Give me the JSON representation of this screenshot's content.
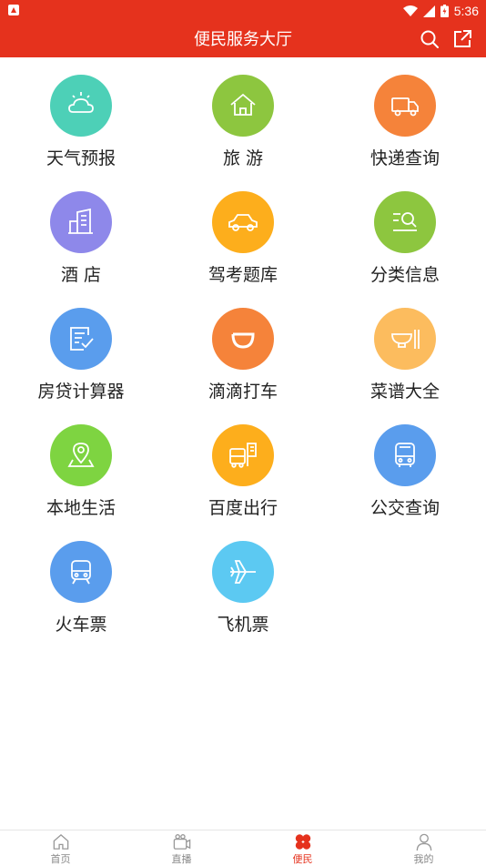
{
  "status_bar": {
    "time": "5:36"
  },
  "header": {
    "title": "便民服务大厅",
    "search_icon": "search-icon",
    "share_icon": "share-icon",
    "color": "#e5321d"
  },
  "services": [
    {
      "label": "天气预报",
      "icon": "weather-icon",
      "color": "#4dd0b7"
    },
    {
      "label": "旅 游",
      "icon": "travel-icon",
      "color": "#8dc63f"
    },
    {
      "label": "快递查询",
      "icon": "express-truck-icon",
      "color": "#f5833a"
    },
    {
      "label": "酒 店",
      "icon": "hotel-icon",
      "color": "#8e88ea"
    },
    {
      "label": "驾考题库",
      "icon": "car-icon",
      "color": "#fdae1c"
    },
    {
      "label": "分类信息",
      "icon": "classified-search-icon",
      "color": "#8dc63f"
    },
    {
      "label": "房贷计算器",
      "icon": "loan-calculator-icon",
      "color": "#5a9ded"
    },
    {
      "label": "滴滴打车",
      "icon": "didi-icon",
      "color": "#f5833a"
    },
    {
      "label": "菜谱大全",
      "icon": "recipe-bowl-icon",
      "color": "#fcbc5e"
    },
    {
      "label": "本地生活",
      "icon": "location-pin-icon",
      "color": "#7ed441"
    },
    {
      "label": "百度出行",
      "icon": "bus-sign-icon",
      "color": "#fdae1c"
    },
    {
      "label": "公交查询",
      "icon": "bus-icon",
      "color": "#5a9ded"
    },
    {
      "label": "火车票",
      "icon": "train-icon",
      "color": "#5a9ded"
    },
    {
      "label": "飞机票",
      "icon": "airplane-icon",
      "color": "#5cc9f2"
    }
  ],
  "tabs": [
    {
      "label": "首页",
      "icon": "home-icon",
      "active": false
    },
    {
      "label": "直播",
      "icon": "live-tv-icon",
      "active": false
    },
    {
      "label": "便民",
      "icon": "clover-icon",
      "active": true
    },
    {
      "label": "我的",
      "icon": "profile-icon",
      "active": false
    }
  ]
}
